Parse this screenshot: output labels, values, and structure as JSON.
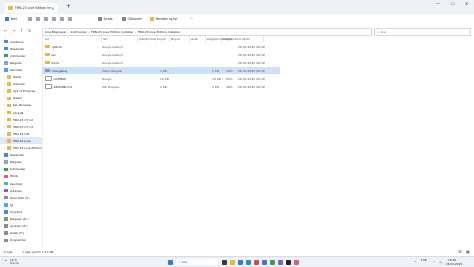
{
  "window": {
    "tab_title": "FRN-23 Live Edition Installer",
    "new_tab": "+",
    "minimize": "—",
    "maximize": "☐",
    "close": "✕"
  },
  "toolbar": {
    "new_label": "Yeni",
    "sort_label": "Sırala",
    "view_label": "Görünüm",
    "filter_label": "Yeniden aç/iyi",
    "more_label": "···"
  },
  "address": {
    "path": [
      "Ana Bilgisayar",
      "İndirilenler",
      "FRN-23 Live Edition Installer",
      "FRN-23 Live Edition Installer"
    ],
    "search_placeholder": "Ara"
  },
  "sidebar": {
    "items": [
      {
        "label": "OneDrive",
        "color": "#3b8de0",
        "chev": "›",
        "indent": 0
      },
      {
        "label": "Masaüstü",
        "color": "#3b8de0",
        "chev": "",
        "indent": 0
      },
      {
        "label": "İndirilenler",
        "color": "#2f9e6a",
        "chev": "",
        "indent": 0
      },
      {
        "label": "Belgeler",
        "color": "#8aa3c7",
        "chev": "",
        "indent": 0
      },
      {
        "label": "Resimler",
        "color": "#4aa4e8",
        "chev": "",
        "indent": 0
      },
      {
        "label": "Müzik",
        "color": "#e8b84a",
        "chev": "›",
        "indent": 1
      },
      {
        "label": "Videolar",
        "color": "#e8b84a",
        "chev": "›",
        "indent": 1
      },
      {
        "label": "Age of Empires",
        "color": "#e8b84a",
        "chev": "›",
        "indent": 1
      },
      {
        "label": "Steam",
        "color": "#e8b84a",
        "chev": "›",
        "indent": 1
      },
      {
        "label": "Zen Browser",
        "color": "#e8b84a",
        "chev": "›",
        "indent": 1
      },
      {
        "label": "v2rayN",
        "color": "#e8b84a",
        "chev": "›",
        "indent": 1
      },
      {
        "label": "FRN-23 CT v2",
        "color": "#e8b84a",
        "chev": "›",
        "indent": 1
      },
      {
        "label": "FRN-23 CT v3",
        "color": "#e8b84a",
        "chev": "›",
        "indent": 1
      },
      {
        "label": "FRN-23 CM",
        "color": "#e8b84a",
        "chev": "›",
        "indent": 1
      },
      {
        "label": "FRN-23 Live",
        "color": "#e8b84a",
        "chev": "›",
        "indent": 1
      },
      {
        "label": "FRN-23 Live Edition",
        "color": "#e8b84a",
        "chev": "›",
        "indent": 1
      },
      {
        "label": "Masaüstü",
        "color": "#3b8de0",
        "chev": "›",
        "indent": 0
      },
      {
        "label": "Belgeler",
        "color": "#8aa3c7",
        "chev": "›",
        "indent": 0
      },
      {
        "label": "İndirilenler",
        "color": "#2f9e6a",
        "chev": "›",
        "indent": 0
      },
      {
        "label": "Müzik",
        "color": "#e05a7a",
        "chev": "›",
        "indent": 0
      },
      {
        "label": "Resimler",
        "color": "#4aa4e8",
        "chev": "›",
        "indent": 0
      },
      {
        "label": "Videolar",
        "color": "#7b5fd6",
        "chev": "›",
        "indent": 0
      },
      {
        "label": "Yerel Disk (C:)",
        "color": "#8a8a8a",
        "chev": "›",
        "indent": 0
      },
      {
        "label": "Ağ",
        "color": "#4aa4e8",
        "chev": "›",
        "indent": 0
      },
      {
        "label": "Dropbox",
        "color": "#3b8de0",
        "chev": "›",
        "indent": 0
      },
      {
        "label": "Belgeler (D:)",
        "color": "#8a8a8a",
        "chev": "›",
        "indent": 0
      },
      {
        "label": "Oyunlar (E:)",
        "color": "#8a8a8a",
        "chev": "›",
        "indent": 0
      },
      {
        "label": "Yedek (F:)",
        "color": "#8a8a8a",
        "chev": "›",
        "indent": 0
      },
      {
        "label": "Programlar",
        "color": "#8a8a8a",
        "chev": "›",
        "indent": 0
      }
    ]
  },
  "columns": {
    "name": "Ad",
    "date": "Değiştirme tarihi",
    "type": "Tür",
    "size": "Boyut",
    "compressed": "Sıkıştırılmış boyut",
    "ratio": "Oran",
    "modified": "Değiştirilme tarihi"
  },
  "files": [
    {
      "name": ".github",
      "type": "Dosya klasörü",
      "icon": "#e8b84a",
      "size": "",
      "compressed": "",
      "ratio": "",
      "date": "26.03.2025 08:40",
      "selected": false
    },
    {
      "name": "bin",
      "type": "Dosya klasörü",
      "icon": "#e8b84a",
      "size": "",
      "compressed": "",
      "ratio": "",
      "date": "26.03.2025 08:40",
      "selected": false
    },
    {
      "name": "fonts",
      "type": "Dosya klasörü",
      "icon": "#e8b84a",
      "size": "",
      "compressed": "",
      "ratio": "",
      "date": "26.03.2025 08:40",
      "selected": false
    },
    {
      "name": "changelog",
      "type": "Metin Belgesi",
      "icon": "#7d98c2",
      "size": "2 KB",
      "compressed": "1 KB",
      "ratio": "44%",
      "date": "26.03.2025 08:40",
      "selected": true
    },
    {
      "name": "LICENSE",
      "type": "Dosya",
      "icon": "#ffffff",
      "size": "34 KB",
      "compressed": "12 KB",
      "ratio": "65%",
      "date": "26.03.2025 08:40",
      "selected": false
    },
    {
      "name": "README.md",
      "type": "MD Dosyası",
      "icon": "#ffffff",
      "size": "3 KB",
      "compressed": "2 KB",
      "ratio": "48%",
      "date": "26.03.2025 08:40",
      "selected": false
    }
  ],
  "status": {
    "count": "6 öğe",
    "selection": "1 öğe seçildi  1,23 KB"
  },
  "taskbar": {
    "search": "Ara",
    "weather_temp": "14°C",
    "weather_text": "Bulutlu",
    "lang": "TUR",
    "time": "13:48",
    "date": "26.03.2025"
  }
}
